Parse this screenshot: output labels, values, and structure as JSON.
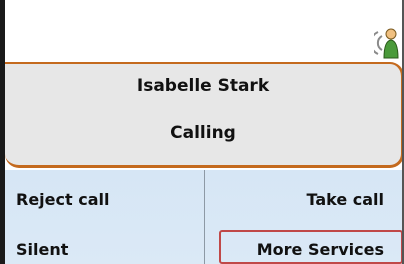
{
  "call": {
    "caller_name": "Isabelle Stark",
    "status": "Calling"
  },
  "softkeys": {
    "reject": "Reject call",
    "take": "Take call",
    "silent": "Silent",
    "more_services": "More Services"
  },
  "icons": {
    "status_icon": "signal-person-icon"
  },
  "colors": {
    "accent_border": "#c46a1e",
    "panel_bg": "#e7e7e7",
    "softkey_bg": "#d6e6f5",
    "highlight": "#c04848"
  }
}
